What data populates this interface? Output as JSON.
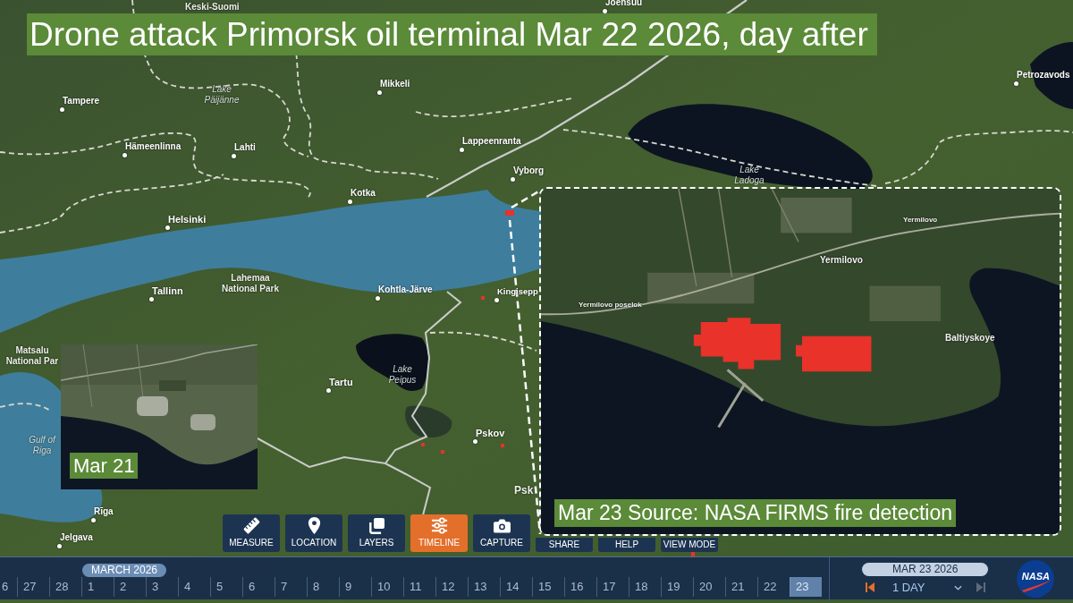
{
  "title": "Drone attack Primorsk oil terminal Mar 22 2026, day after",
  "map": {
    "labels": [
      {
        "kind": "city",
        "text": "Joensuu"
      },
      {
        "kind": "place",
        "text": "Keski-Suomi"
      },
      {
        "kind": "city",
        "text": "Petrozavods"
      },
      {
        "kind": "water",
        "text": "Lake Päijänne"
      },
      {
        "kind": "city",
        "text": "Mikkeli"
      },
      {
        "kind": "city",
        "text": "Tampere"
      },
      {
        "kind": "city",
        "text": "Hämeenlinna"
      },
      {
        "kind": "city",
        "text": "Lahti"
      },
      {
        "kind": "city",
        "text": "Lappeenranta"
      },
      {
        "kind": "city",
        "text": "Vyborg"
      },
      {
        "kind": "water",
        "text": "Lake Ladoga"
      },
      {
        "kind": "city",
        "text": "Kotka"
      },
      {
        "kind": "city",
        "text": "Helsinki"
      },
      {
        "kind": "city",
        "text": "Tallinn"
      },
      {
        "kind": "place",
        "text": "Lahemaa National Park"
      },
      {
        "kind": "city",
        "text": "Kohtla-Järve"
      },
      {
        "kind": "city",
        "text": "Kingisepp"
      },
      {
        "kind": "place",
        "text": "Matsalu National Par"
      },
      {
        "kind": "city",
        "text": "Tartu"
      },
      {
        "kind": "water",
        "text": "Lake Peipus"
      },
      {
        "kind": "city",
        "text": "Pskov"
      },
      {
        "kind": "water",
        "text": "Gulf of Riga"
      },
      {
        "kind": "place",
        "text": "Psk"
      },
      {
        "kind": "city",
        "text": "Rīga"
      },
      {
        "kind": "city",
        "text": "Jelgava"
      }
    ]
  },
  "insets": [
    {
      "caption": "Mar 21"
    },
    {
      "caption": "Mar 23 Source: NASA FIRMS fire detection",
      "labels": [
        "Yermilovo",
        "Yermilovo",
        "Yermilovo poselok",
        "Baltiyskoye"
      ]
    }
  ],
  "toolbar": [
    {
      "label": "MEASURE",
      "selected": false
    },
    {
      "label": "LOCATION",
      "selected": false
    },
    {
      "label": "LAYERS",
      "selected": false
    },
    {
      "label": "TIMELINE",
      "selected": true
    },
    {
      "label": "CAPTURE",
      "selected": false
    },
    {
      "label": "SHARE",
      "selected": false
    },
    {
      "label": "HELP",
      "selected": false
    },
    {
      "label": "VIEW MODE",
      "selected": false
    }
  ],
  "timeline": {
    "month": "MARCH 2026",
    "days": [
      {
        "label": "6",
        "selected": false
      },
      {
        "label": "27",
        "selected": false
      },
      {
        "label": "28",
        "selected": false
      },
      {
        "label": "1",
        "selected": false
      },
      {
        "label": "2",
        "selected": false
      },
      {
        "label": "3",
        "selected": false
      },
      {
        "label": "4",
        "selected": false
      },
      {
        "label": "5",
        "selected": false
      },
      {
        "label": "6",
        "selected": false
      },
      {
        "label": "7",
        "selected": false
      },
      {
        "label": "8",
        "selected": false
      },
      {
        "label": "9",
        "selected": false
      },
      {
        "label": "10",
        "selected": false
      },
      {
        "label": "11",
        "selected": false
      },
      {
        "label": "12",
        "selected": false
      },
      {
        "label": "13",
        "selected": false
      },
      {
        "label": "14",
        "selected": false
      },
      {
        "label": "15",
        "selected": false
      },
      {
        "label": "16",
        "selected": false
      },
      {
        "label": "17",
        "selected": false
      },
      {
        "label": "18",
        "selected": false
      },
      {
        "label": "19",
        "selected": false
      },
      {
        "label": "20",
        "selected": false
      },
      {
        "label": "21",
        "selected": false
      },
      {
        "label": "22",
        "selected": false
      },
      {
        "label": "23",
        "selected": true
      }
    ],
    "date": "MAR 23 2026",
    "step_buttons": [
      {
        "disabled": false
      },
      {
        "disabled": true
      }
    ],
    "interval": "1 DAY",
    "logo": "NASA"
  }
}
